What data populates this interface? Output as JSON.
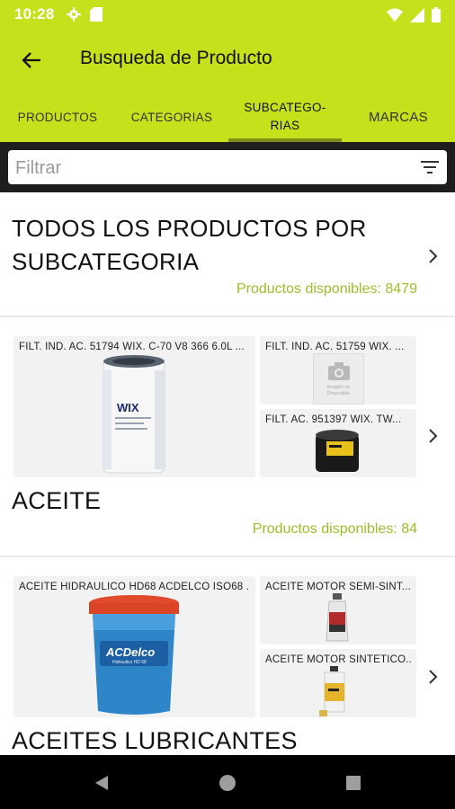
{
  "status": {
    "time": "10:28"
  },
  "appbar": {
    "title": "Busqueda de Producto"
  },
  "tabs": [
    {
      "label": "PRODUCTOS"
    },
    {
      "label": "CATEGORIAS"
    },
    {
      "label": "SUBCATEGO-\nRIAS"
    },
    {
      "label": "MARCAS"
    }
  ],
  "filter": {
    "placeholder": "Filtrar"
  },
  "all_products": {
    "title": "TODOS LOS PRODUCTOS POR SUBCATEGORIA",
    "available": "Productos disponibles: 8479"
  },
  "categories": [
    {
      "name": "ACEITE",
      "available": "Productos disponibles: 84",
      "products": [
        {
          "label": "FILT. IND. AC. 51794 WIX. C-70 V8 366 6.0L ...",
          "image": "oil-filter-wix-large"
        },
        {
          "label": "FILT. IND. AC. 51759  WIX. ...",
          "image": "no-image-placeholder",
          "placeholder_text": "Imagen no Disponible"
        },
        {
          "label": "FILT. AC. 951397 WIX.    TW...",
          "image": "oil-filter-black-small"
        }
      ]
    },
    {
      "name": "ACEITES LUBRICANTES",
      "products": [
        {
          "label": "ACEITE HIDRAULICO HD68 ACDELCO ISO68 ...",
          "image": "acdelco-bucket",
          "brand": "ACDelco",
          "product_text": "Hidraulico HD 68"
        },
        {
          "label": "ACEITE MOTOR SEMI-SINT...",
          "image": "motor-oil-bottle"
        },
        {
          "label": "ACEITE MOTOR SINTETICO...",
          "image": "synthetic-oil-bottle"
        }
      ]
    }
  ],
  "colors": {
    "accent": "#c5e11b",
    "available_text": "#9bbf2a"
  }
}
